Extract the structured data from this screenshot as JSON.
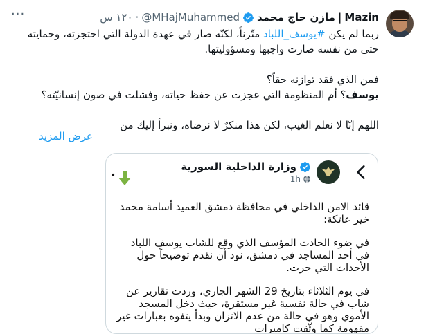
{
  "tweet": {
    "author_name_latin": "Mazin",
    "author_name_separator": "|",
    "author_name_ar": "مازن حاج محمد",
    "handle": "@MHajMuhammed",
    "dot": "·",
    "time": "١٢٠ س",
    "more_label": "···",
    "verified_color": "#1d9bf0",
    "body": {
      "line1_pre": "ربما لم يكن ",
      "line1_hashtag": "#يوسف_اللباد",
      "line1_post": " متّزناً، لكنّه صار في عهدة الدولة التي احتجزته، وحمايته",
      "line2": "حتى من نفسه صارت واجبها ومسؤوليتها.",
      "line3": "فمن الذي فقد توازنه حقاً؟",
      "line4_bold": "يوسف",
      "line4_rest": "؟ أم المنظومة التي عجزت عن حفظ حياته، وفشلت في صون إنسانيّته؟",
      "line5": "اللهم إنّا لا نعلم الغيب، لكن هذا منكرٌ لا نرضاه، ونبرأ إليك من"
    },
    "show_more": "عرض المزيد"
  },
  "quoted": {
    "account_name": "وزارة الداخلية السورية",
    "time": "1h",
    "dot": "•",
    "paragraphs": [
      "قائد الامن الداخلي في محافظة دمشق العميد أسامة محمد خير عاتكة:",
      "في ضوء الحادث المؤسف الذي وقع للشاب يوسف اللباد في أحد المساجد في دمشق، نود أن نقدم توضيحاً حول الأحداث التي جرت.",
      "في يوم الثلاثاء بتاريخ 29 الشهر الجاري، وردت تقارير عن شاب في حالة نفسية غير مستقرة، حيث دخل المسجد الأموي وهو في حالة من عدم الاتزان وبدأ يتفوه بعبارات غير مفهومة كما وثّقت كاميرات"
    ],
    "download_arrow_color": "#7cb342"
  },
  "icons": {
    "avatar": "profile-photo",
    "verified": "verified-badge-icon",
    "more": "more-options-icon",
    "back": "chevron-left-icon",
    "emblem": "ministry-emblem-icon",
    "globe": "globe-icon",
    "download": "down-arrow-icon"
  }
}
